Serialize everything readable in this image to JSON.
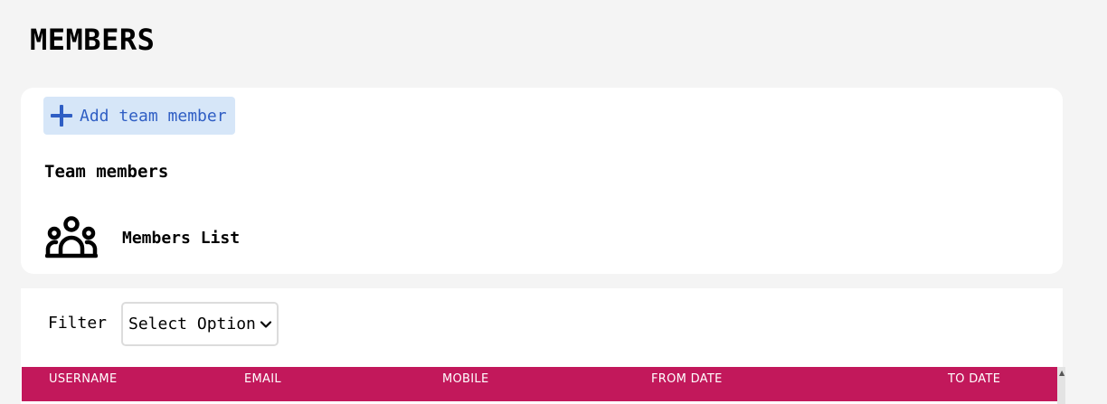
{
  "page": {
    "title": "MEMBERS"
  },
  "team_card": {
    "add_button_label": "Add team member",
    "add_button_icon": "plus-icon",
    "heading": "Team members",
    "members_list_label": "Members List",
    "members_list_icon": "users-group-icon"
  },
  "filter": {
    "label": "Filter",
    "selected_value": "Select Option"
  },
  "table": {
    "columns": [
      "USERNAME",
      "EMAIL",
      "MOBILE",
      "FROM DATE",
      "TO DATE"
    ]
  },
  "colors": {
    "page_background": "#f4f4f4",
    "button_background": "#d6e6f8",
    "button_text": "#2f5ec4",
    "table_header_background": "#c2185b"
  }
}
